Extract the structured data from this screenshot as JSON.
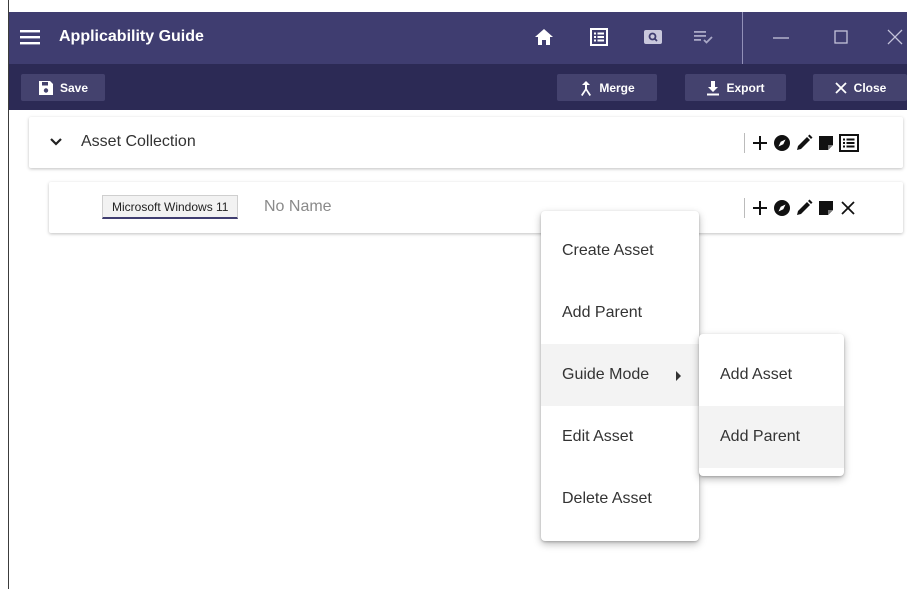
{
  "app": {
    "title": "Applicability Guide"
  },
  "toolbar": {
    "save_label": "Save",
    "merge_label": "Merge",
    "export_label": "Export",
    "close_label": "Close"
  },
  "collection": {
    "label": "Asset Collection"
  },
  "asset": {
    "chip": "Microsoft Windows 11",
    "name": "No Name"
  },
  "context_menu": {
    "items": [
      "Create Asset",
      "Add Parent",
      "Guide Mode",
      "Edit Asset",
      "Delete Asset"
    ],
    "highlighted": "Guide Mode"
  },
  "submenu": {
    "items": [
      "Add Asset",
      "Add Parent"
    ],
    "highlighted": "Add Parent"
  },
  "colors": {
    "titlebar": "#3f3d70",
    "toolbar": "#2c2a55",
    "button": "#44426e"
  }
}
